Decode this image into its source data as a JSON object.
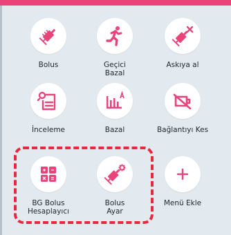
{
  "accent_color": "#e9437a",
  "highlight_color": "#e8283e",
  "menu": {
    "items": [
      {
        "label": "Bolus",
        "icon": "syringe-icon"
      },
      {
        "label": "Geçici\nBazal",
        "icon": "running-person-icon"
      },
      {
        "label": "Askıya al",
        "icon": "syringe-cross-icon"
      },
      {
        "label": "İnceleme",
        "icon": "review-document-icon"
      },
      {
        "label": "Bazal",
        "icon": "basal-chart-icon"
      },
      {
        "label": "Bağlantıyı Kes",
        "icon": "disconnect-icon"
      },
      {
        "label": "BG Bolus\nHesaplayıcı",
        "icon": "calculator-icon"
      },
      {
        "label": "Bolus\nAyar",
        "icon": "syringe-gear-icon"
      },
      {
        "label": "Menü Ekle",
        "icon": "plus-icon"
      }
    ]
  }
}
